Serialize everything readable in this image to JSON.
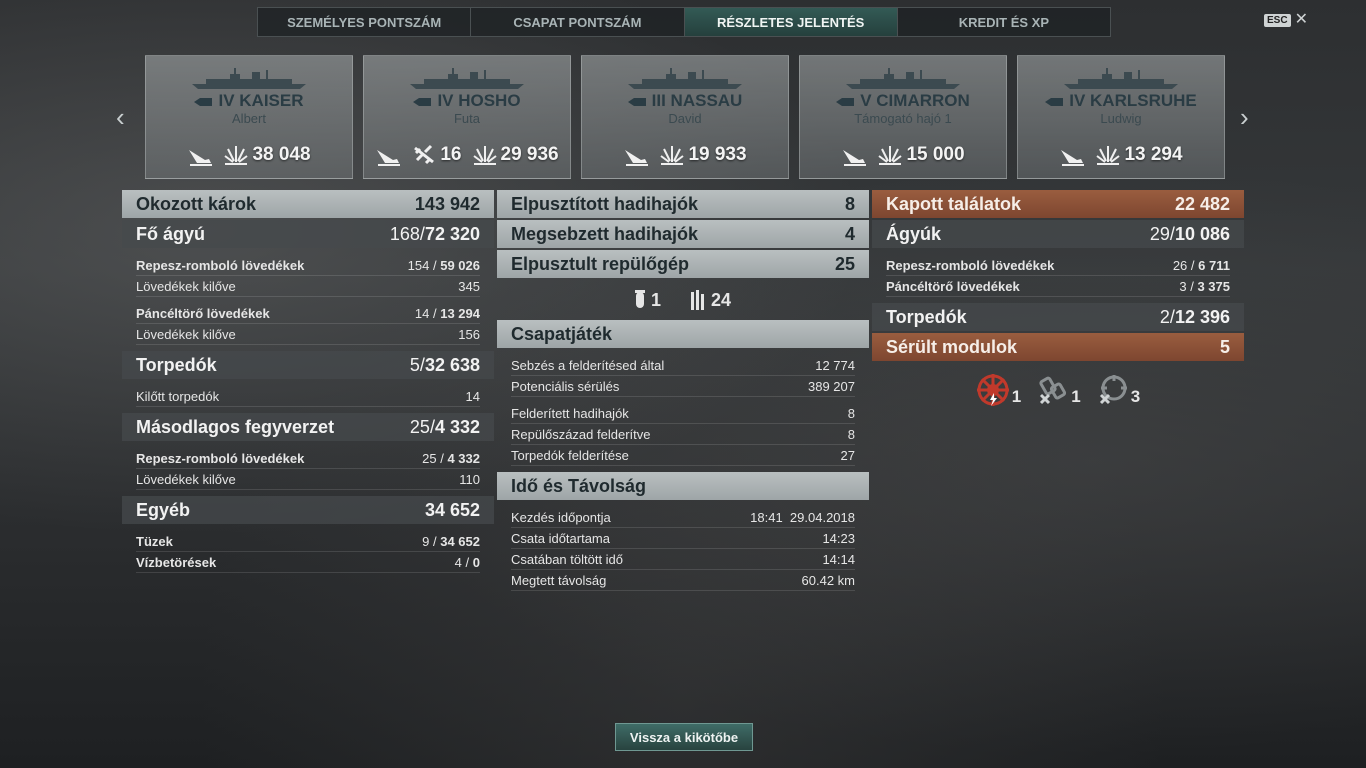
{
  "tabs": [
    {
      "label": "SZEMÉLYES PONTSZÁM",
      "active": false
    },
    {
      "label": "CSAPAT PONTSZÁM",
      "active": false
    },
    {
      "label": "RÉSZLETES JELENTÉS",
      "active": true
    },
    {
      "label": "KREDIT ÉS XP",
      "active": false
    }
  ],
  "esc_label": "ESC",
  "close_glyph": "✕",
  "nav": {
    "prev": "‹",
    "next": "›"
  },
  "ships": [
    {
      "name": "IV KAISER",
      "player": "Albert",
      "type_icon": "battleship-icon",
      "planes": null,
      "damage": "38 048"
    },
    {
      "name": "IV HOSHO",
      "player": "Futa",
      "type_icon": "carrier-icon",
      "planes": "16",
      "damage": "29 936"
    },
    {
      "name": "III NASSAU",
      "player": "David",
      "type_icon": "battleship-icon",
      "planes": null,
      "damage": "19 933"
    },
    {
      "name": "V CIMARRON",
      "player": "Támogató hajó 1",
      "type_icon": "auxiliary-icon",
      "planes": null,
      "damage": "15 000"
    },
    {
      "name": "IV KARLSRUHE",
      "player": "Ludwig",
      "type_icon": "cruiser-icon",
      "planes": null,
      "damage": "13 294"
    }
  ],
  "left": {
    "damage": {
      "label": "Okozott károk",
      "value": "143 942"
    },
    "main": {
      "label": "Fő ágyú",
      "hits": "168",
      "dmg": "72 320",
      "he": {
        "label": "Repesz-romboló lövedékek",
        "hits": "154",
        "dmg": "59 026"
      },
      "he_fired": {
        "label": "Lövedékek kilőve",
        "value": "345"
      },
      "ap": {
        "label": "Páncéltörő lövedékek",
        "hits": "14",
        "dmg": "13 294"
      },
      "ap_fired": {
        "label": "Lövedékek kilőve",
        "value": "156"
      }
    },
    "torp": {
      "label": "Torpedók",
      "hits": "5",
      "dmg": "32 638",
      "fired": {
        "label": "Kilőtt torpedók",
        "value": "14"
      }
    },
    "sec": {
      "label": "Másodlagos fegyverzet",
      "hits": "25",
      "dmg": "4 332",
      "he": {
        "label": "Repesz-romboló lövedékek",
        "hits": "25",
        "dmg": "4 332"
      },
      "fired": {
        "label": "Lövedékek kilőve",
        "value": "110"
      }
    },
    "other": {
      "label": "Egyéb",
      "value": "34 652",
      "fires": {
        "label": "Tüzek",
        "hits": "9",
        "dmg": "34 652"
      },
      "flood": {
        "label": "Vízbetörések",
        "hits": "4",
        "dmg": "0"
      }
    }
  },
  "mid": {
    "destroyed": {
      "label": "Elpusztított hadihajók",
      "value": "8"
    },
    "damaged": {
      "label": "Megsebzett hadihajók",
      "value": "4"
    },
    "planes": {
      "label": "Elpusztult repülőgép",
      "value": "25"
    },
    "plane_icons": {
      "bombers": "1",
      "fighters": "24"
    },
    "team": {
      "label": "Csapatjáték",
      "rows": [
        {
          "label": "Sebzés a felderítésed által",
          "value": "12 774"
        },
        {
          "label": "Potenciális sérülés",
          "value": "389 207"
        },
        {
          "label": "Felderített hadihajók",
          "value": "8"
        },
        {
          "label": "Repülőszázad felderítve",
          "value": "8"
        },
        {
          "label": "Torpedók felderítése",
          "value": "27"
        }
      ]
    },
    "time": {
      "label": "Idő és Távolság",
      "rows": [
        {
          "label": "Kezdés időpontja",
          "value": "18:41  29.04.2018"
        },
        {
          "label": "Csata időtartama",
          "value": "14:23"
        },
        {
          "label": "Csatában töltött idő",
          "value": "14:14"
        },
        {
          "label": "Megtett távolság",
          "value": "60.42 km"
        }
      ]
    }
  },
  "right": {
    "received": {
      "label": "Kapott találatok",
      "value": "22 482"
    },
    "guns": {
      "label": "Ágyúk",
      "hits": "29",
      "dmg": "10 086",
      "he": {
        "label": "Repesz-romboló lövedékek",
        "hits": "26",
        "dmg": "6 711"
      },
      "ap": {
        "label": "Páncéltörő lövedékek",
        "hits": "3",
        "dmg": "3 375"
      }
    },
    "torp": {
      "label": "Torpedók",
      "hits": "2",
      "dmg": "12 396"
    },
    "modules": {
      "label": "Sérült modulok",
      "value": "5",
      "icons": [
        {
          "name": "steering-gear-icon",
          "count": "1"
        },
        {
          "name": "engine-icon",
          "count": "1"
        },
        {
          "name": "turret-icon",
          "count": "3"
        }
      ]
    }
  },
  "back_button": "Vissza a kikötőbe",
  "separator": "/"
}
